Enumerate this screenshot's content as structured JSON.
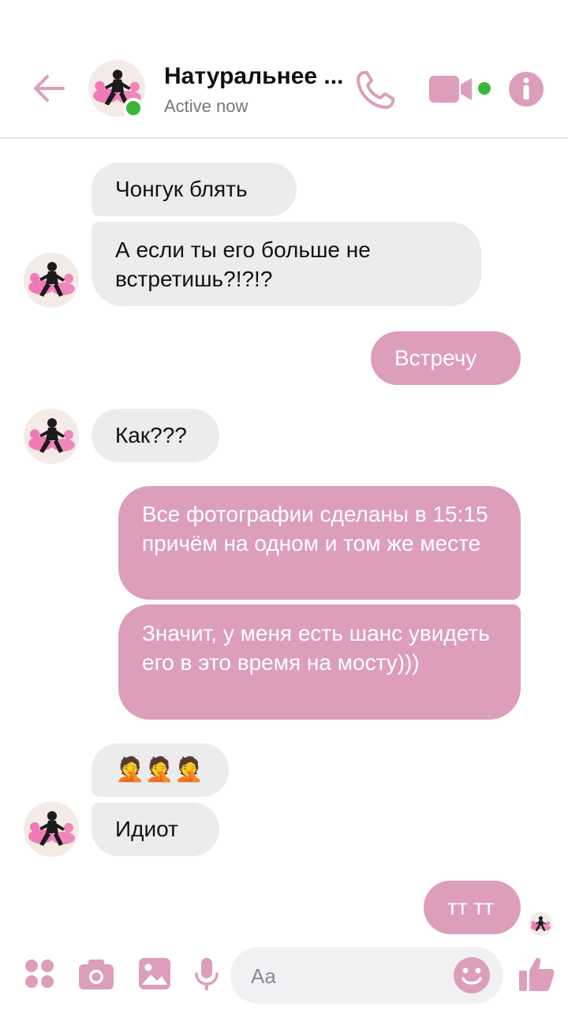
{
  "header": {
    "title": "Натуральнее ...",
    "status": "Active now"
  },
  "messages": [
    {
      "side": "in",
      "text": "Чонгук блять"
    },
    {
      "side": "in",
      "text": "А если ты его больше не встретишь?!?!?"
    },
    {
      "side": "out",
      "text": "Встречу"
    },
    {
      "side": "in",
      "text": "Как???"
    },
    {
      "side": "out",
      "text": "Все фотографии сделаны в 15:15 причём на одном и том же месте"
    },
    {
      "side": "out",
      "text": "Значит, у меня есть шанс увидеть его в это время на мосту)))"
    },
    {
      "side": "in",
      "text": "🤦🤦🤦"
    },
    {
      "side": "in",
      "text": "Идиот"
    },
    {
      "side": "out",
      "text": "тт тт"
    }
  ],
  "composer": {
    "placeholder": "Aa"
  },
  "icons": {
    "back": "arrow-left-icon",
    "call": "phone-icon",
    "video": "video-camera-icon",
    "info": "info-icon",
    "more": "four-dots-icon",
    "camera": "camera-icon",
    "gallery": "image-icon",
    "mic": "microphone-icon",
    "emoji": "smiley-icon",
    "like": "thumbs-up-icon"
  },
  "colors": {
    "accent": "#dc9ebb",
    "online": "#3ab53a",
    "incoming_bubble": "#ececef"
  }
}
